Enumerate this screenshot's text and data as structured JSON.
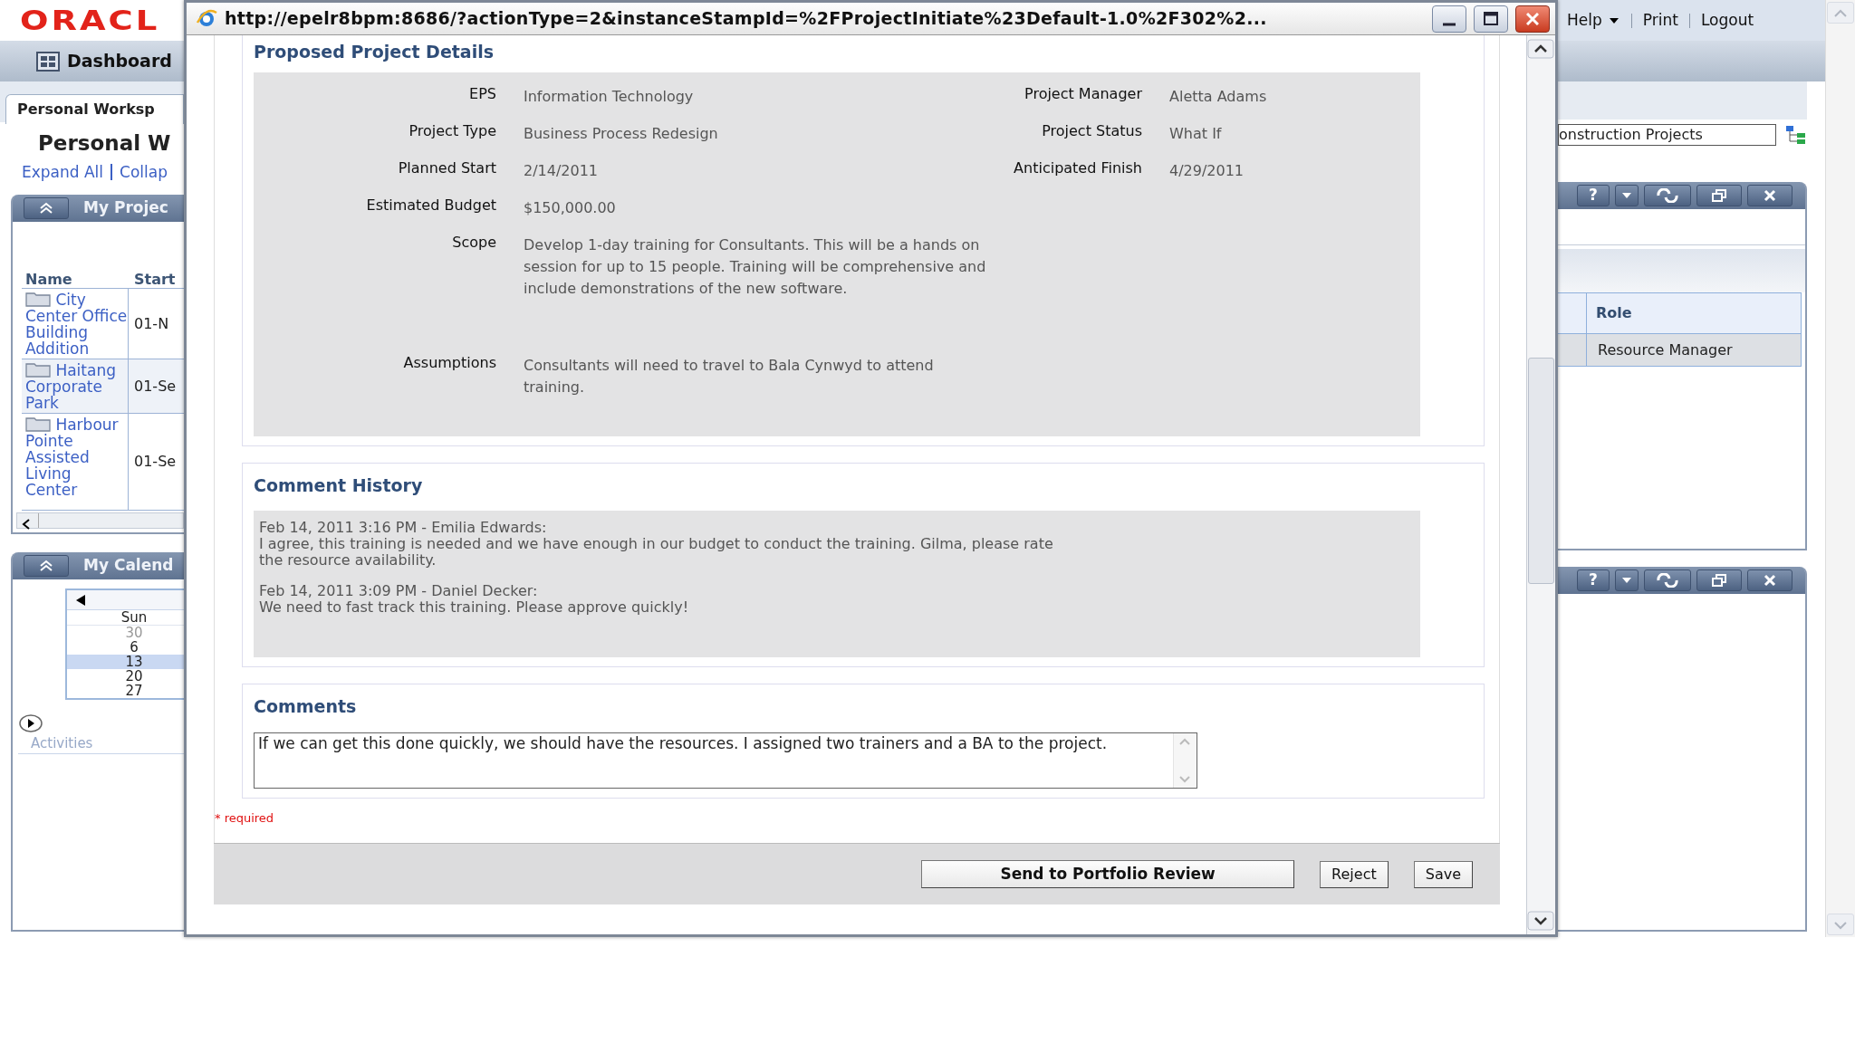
{
  "app": {
    "logo": "ORACL",
    "top_links": [
      "Help",
      "Print",
      "Logout"
    ],
    "nav_item": "Dashboard",
    "tab": "Personal Worksp",
    "page_title": "Personal W",
    "page_links": [
      "Expand All",
      "Collap"
    ],
    "projects_portlet": {
      "title": "My Projec",
      "columns": [
        "Name",
        "Start"
      ],
      "rows": [
        {
          "name": "City Center Office Building Addition",
          "start": "01-N",
          "selected": false
        },
        {
          "name": "Haitang Corporate Park",
          "start": "01-Se",
          "selected": true
        },
        {
          "name": "Harbour Pointe Assisted Living Center",
          "start": "01-Se",
          "selected": false
        }
      ]
    },
    "calendar_portlet": {
      "title": "My Calend",
      "day_header": "Sun",
      "days": [
        {
          "label": "30",
          "other_month": true,
          "selected": false
        },
        {
          "label": "6",
          "other_month": false,
          "selected": false
        },
        {
          "label": "13",
          "other_month": false,
          "selected": true
        },
        {
          "label": "20",
          "other_month": false,
          "selected": false
        },
        {
          "label": "27",
          "other_month": false,
          "selected": false
        }
      ],
      "activities": "Activities"
    },
    "filter_value": "onstruction Projects",
    "resources_portlet": {
      "help": "?",
      "columns": [
        "Role"
      ],
      "rows": [
        "Resource Manager"
      ]
    },
    "empty_portlet": {
      "help": "?"
    }
  },
  "popup": {
    "title": "http://epelr8bpm:8686/?actionType=2&instanceStampId=%2FProjectInitiate%23Default-1.0%2F302%2...",
    "section_title": "Proposed Project Details",
    "details": [
      [
        {
          "label": "EPS",
          "value": "Information Technology"
        },
        {
          "label": "Project Manager",
          "value": "Aletta Adams"
        }
      ],
      [
        {
          "label": "Project Type",
          "value": "Business Process Redesign"
        },
        {
          "label": "Project Status",
          "value": "What If"
        }
      ],
      [
        {
          "label": "Planned Start",
          "value": "2/14/2011"
        },
        {
          "label": "Anticipated Finish",
          "value": "4/29/2011"
        }
      ],
      [
        {
          "label": "Estimated Budget",
          "value": "$150,000.00"
        }
      ],
      [
        {
          "label": "Scope",
          "value": "Develop 1-day training for Consultants. This will be a hands on session for up to 15 people. Training will be comprehensive and include demonstrations of the new software."
        }
      ],
      [
        {
          "label": "Assumptions",
          "value": "Consultants will need to travel to Bala Cynwyd to attend training."
        }
      ]
    ],
    "history_title": "Comment History",
    "history": [
      {
        "meta": "Feb 14, 2011 3:16 PM - Emilia Edwards:",
        "text": "I agree, this training is needed and we have enough in our budget to conduct the training. Gilma, please rate the resource availability."
      },
      {
        "meta": "Feb 14, 2011 3:09 PM - Daniel Decker:",
        "text": "We need to fast track this training. Please approve quickly!"
      }
    ],
    "comments_title": "Comments",
    "comment_value": "If we can get this done quickly, we should have the resources. I assigned two trainers and a BA to the project.",
    "required_note": "* required",
    "buttons": [
      {
        "label": "Send to Portfolio Review",
        "default": true
      },
      {
        "label": "Reject",
        "default": false
      },
      {
        "label": "Save",
        "default": false
      }
    ]
  }
}
